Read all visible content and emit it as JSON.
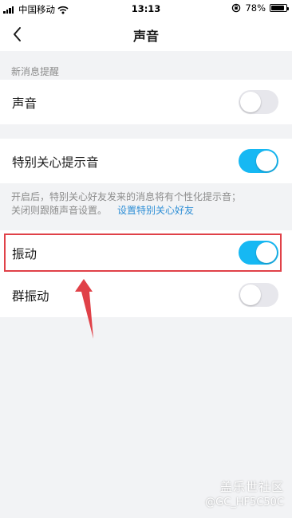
{
  "status_bar": {
    "carrier": "中国移动",
    "time": "13:13",
    "battery": "78%",
    "battery_level": 0.78
  },
  "nav": {
    "title": "声音"
  },
  "section": {
    "new_message_label": "新消息提醒"
  },
  "rows": {
    "sound": {
      "label": "声音",
      "enabled": false
    },
    "special_care": {
      "label": "特别关心提示音",
      "enabled": true
    },
    "vibrate": {
      "label": "振动",
      "enabled": true
    },
    "group_vibrate": {
      "label": "群振动",
      "enabled": false
    }
  },
  "hint": {
    "line1": "开启后，特别关心好友发来的消息将有个性化提示音；",
    "line2": "关闭则跟随声音设置。",
    "link": "设置特别关心好友"
  },
  "annotation": {
    "color": "#e04148"
  },
  "watermark": {
    "title": "盖乐世社区",
    "id": "@GC_HF5C50C"
  },
  "colors": {
    "toggle_on": "#16b8f3",
    "link": "#2f8fd6",
    "background": "#f2f3f5"
  }
}
